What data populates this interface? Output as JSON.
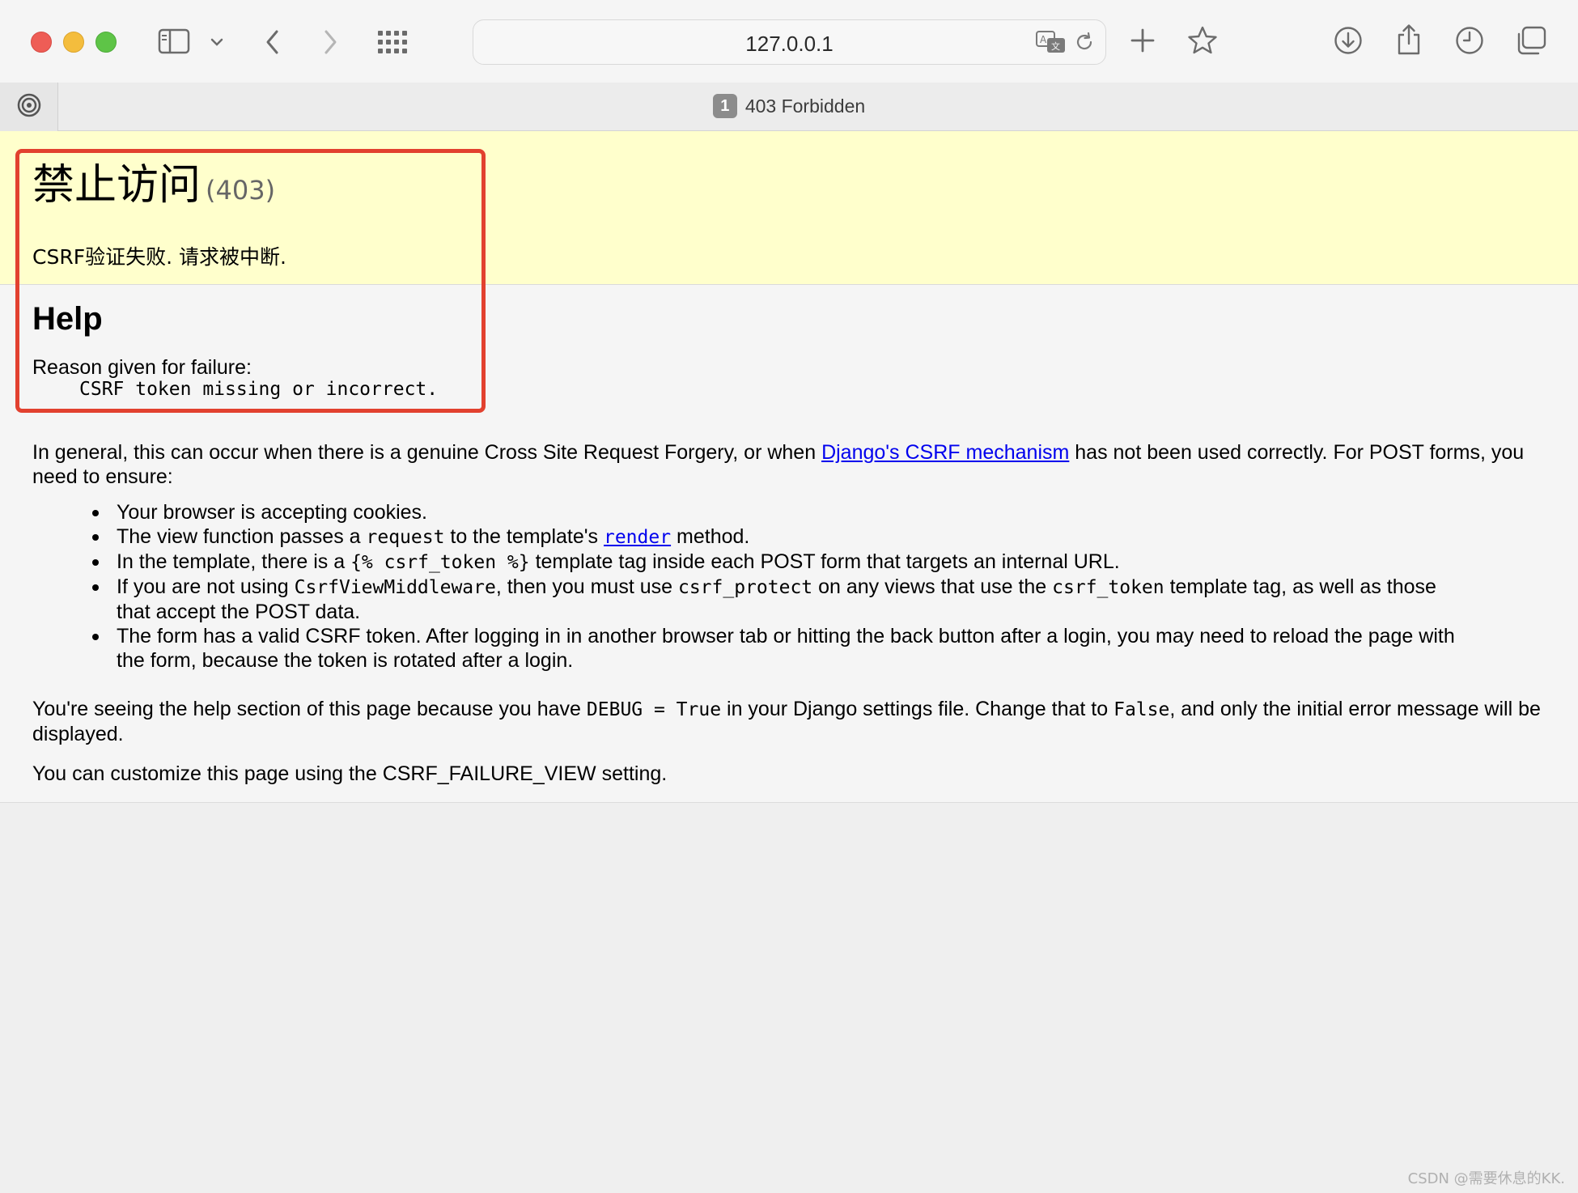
{
  "browser": {
    "url": "127.0.0.1",
    "tab": {
      "badge": "1",
      "title": "403 Forbidden"
    }
  },
  "page": {
    "heading": "禁止访问",
    "status_code": "(403)",
    "summary_message": "CSRF验证失败. 请求被中断.",
    "help_title": "Help",
    "reason_label": "Reason given for failure:",
    "reason_text": "CSRF token missing or incorrect.",
    "intro": {
      "before_link": "In general, this can occur when there is a genuine Cross Site Request Forgery, or when ",
      "link": "Django's CSRF mechanism",
      "after_link": " has not been used correctly. For POST forms, you need to ensure:"
    },
    "bullets": {
      "b1": "Your browser is accepting cookies.",
      "b2_pre": "The view function passes a ",
      "b2_code": "request",
      "b2_mid": " to the template's ",
      "b2_link": "render",
      "b2_post": " method.",
      "b3_pre": "In the template, there is a ",
      "b3_code": "{% csrf_token %}",
      "b3_post": " template tag inside each POST form that targets an internal URL.",
      "b4_pre": "If you are not using ",
      "b4_code1": "CsrfViewMiddleware",
      "b4_mid1": ", then you must use ",
      "b4_code2": "csrf_protect",
      "b4_mid2": " on any views that use the ",
      "b4_code3": "csrf_token",
      "b4_post": " template tag, as well as those that accept the POST data.",
      "b5": "The form has a valid CSRF token. After logging in in another browser tab or hitting the back button after a login, you may need to reload the page with the form, because the token is rotated after a login."
    },
    "debug_note": {
      "pre": "You're seeing the help section of this page because you have ",
      "code1": "DEBUG = True",
      "mid": " in your Django settings file. Change that to ",
      "code2": "False",
      "post": ", and only the initial error message will be displayed."
    },
    "customize_note": "You can customize this page using the CSRF_FAILURE_VIEW setting."
  },
  "watermark": "CSDN @需要休息的KK.",
  "colors": {
    "summary_bg": "#ffffcc",
    "highlight_border": "#e2412f",
    "link": "#0000ee"
  }
}
